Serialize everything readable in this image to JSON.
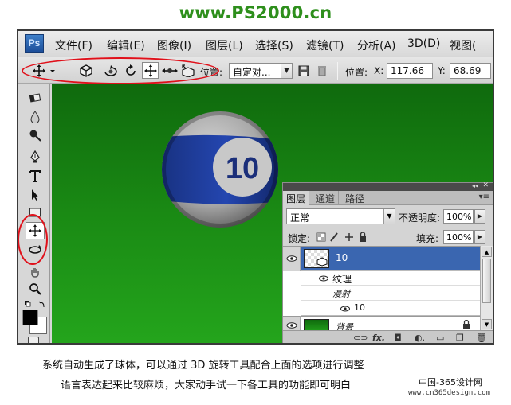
{
  "site_title": "www.PS2000.cn",
  "app": {
    "logo": "Ps",
    "menu": [
      {
        "label": "文件(F)"
      },
      {
        "label": "编辑(E)"
      },
      {
        "label": "图像(I)"
      },
      {
        "label": "图层(L)"
      },
      {
        "label": "选择(S)"
      },
      {
        "label": "滤镜(T)"
      },
      {
        "label": "分析(A)"
      },
      {
        "label": "3D(D)"
      },
      {
        "label": "视图("
      }
    ]
  },
  "options_bar": {
    "position_label": "位置:",
    "position_value": "自定对...",
    "x_label": "X:",
    "x_value": "117.66",
    "y_label": "Y:",
    "y_value": "68.69",
    "icons": [
      "move-tool-icon",
      "3d-object-icon",
      "roll-icon",
      "rotate-icon",
      "drag-icon",
      "slide-icon",
      "scale-icon",
      "save-icon",
      "trash-icon"
    ]
  },
  "ball": {
    "number": "10"
  },
  "layers_panel": {
    "tabs": [
      "图层",
      "通道",
      "路径"
    ],
    "blend_mode": "正常",
    "opacity_label": "不透明度:",
    "opacity_value": "100%",
    "lock_label": "锁定:",
    "fill_label": "填充:",
    "fill_value": "100%",
    "layers": [
      {
        "name": "10",
        "selected": true
      },
      {
        "name": "纹理"
      },
      {
        "name": "漫射"
      },
      {
        "name": "10"
      },
      {
        "name": "背景"
      }
    ]
  },
  "caption": {
    "line1": "系统自动生成了球体，可以通过 3D 旋转工具配合上面的选项进行调整",
    "line2": "语言表达起来比较麻烦，大家动手试一下各工具的功能即可明白"
  },
  "watermark": {
    "line1": "中国-365设计网",
    "line2": "www.cn365design.com"
  },
  "colors": {
    "accent_red": "#e0101a",
    "canvas_green": "#1a8a14",
    "ball_stripe": "#1f3fa0",
    "site_title_green": "#2e8f1c"
  }
}
